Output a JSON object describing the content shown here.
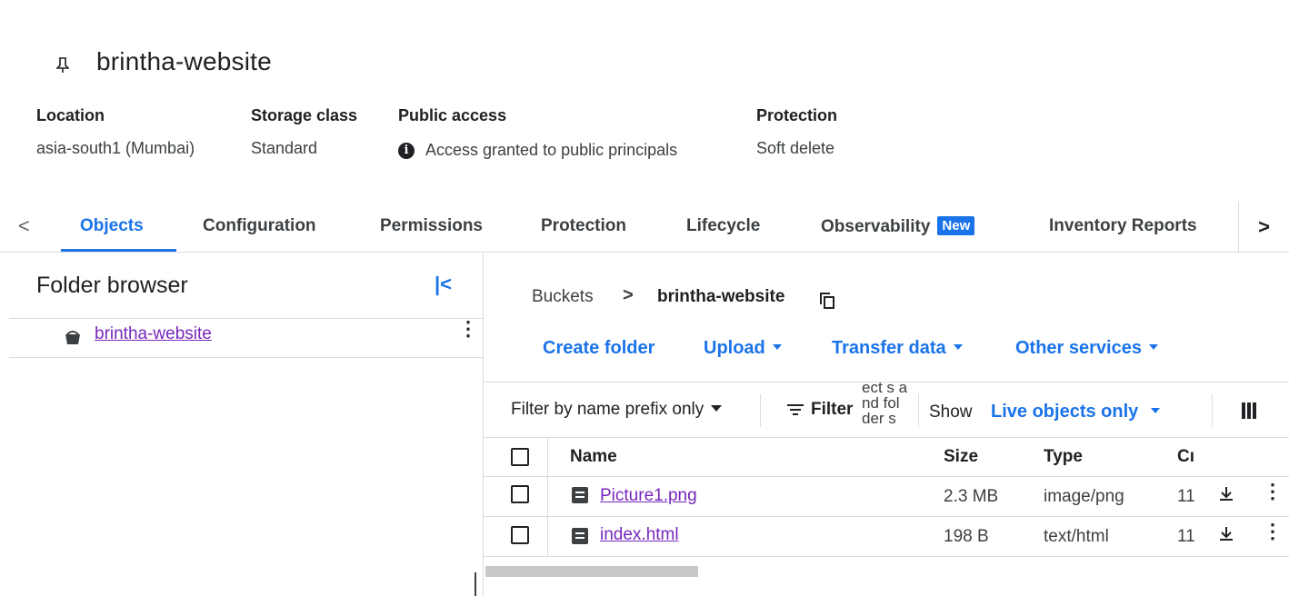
{
  "header": {
    "title": "brintha-website",
    "pin_icon": "pin-icon"
  },
  "meta": {
    "location": {
      "label": "Location",
      "value": "asia-south1 (Mumbai)"
    },
    "storage_class": {
      "label": "Storage class",
      "value": "Standard"
    },
    "public_access": {
      "label": "Public access",
      "value": "Access granted to public principals",
      "icon": "info-icon"
    },
    "protection": {
      "label": "Protection",
      "value": "Soft delete"
    }
  },
  "tabs": [
    {
      "label": "Objects",
      "active": true
    },
    {
      "label": "Configuration"
    },
    {
      "label": "Permissions"
    },
    {
      "label": "Protection"
    },
    {
      "label": "Lifecycle"
    },
    {
      "label": "Observability",
      "badge": "New"
    },
    {
      "label": "Inventory Reports"
    }
  ],
  "tab_nav": {
    "left": "<",
    "right": ">"
  },
  "folder_browser": {
    "title": "Folder browser",
    "collapse_icon": "|<",
    "items": [
      {
        "label": "brintha-website",
        "icon": "bucket-icon"
      }
    ],
    "more": "⋮"
  },
  "breadcrumb": {
    "root": "Buckets",
    "separator": ">",
    "current": "brintha-website",
    "copy_icon": "copy-icon"
  },
  "actions": {
    "create_folder": "Create folder",
    "upload": "Upload",
    "transfer_data": "Transfer data",
    "other_services": "Other services"
  },
  "toolbar": {
    "filter_mode": "Filter by name prefix only",
    "filter_button": "Filter",
    "squeezed_text": "ect s a nd fol der s",
    "show_label": "Show",
    "show_value": "Live objects only",
    "columns_icon": "column-display-icon"
  },
  "table": {
    "headers": {
      "name": "Name",
      "size": "Size",
      "type": "Type",
      "created": "Cı"
    },
    "rows": [
      {
        "name": "Picture1.png",
        "size": "2.3 MB",
        "type": "image/png",
        "created": "11",
        "download_icon": "download-icon",
        "more": "⋮"
      },
      {
        "name": "index.html",
        "size": "198 B",
        "type": "text/html",
        "created": "11",
        "download_icon": "download-icon",
        "more": "⋮"
      }
    ]
  },
  "colors": {
    "accent": "#1a73e8",
    "link_visited": "#7627bb",
    "divider": "#dadce0"
  }
}
